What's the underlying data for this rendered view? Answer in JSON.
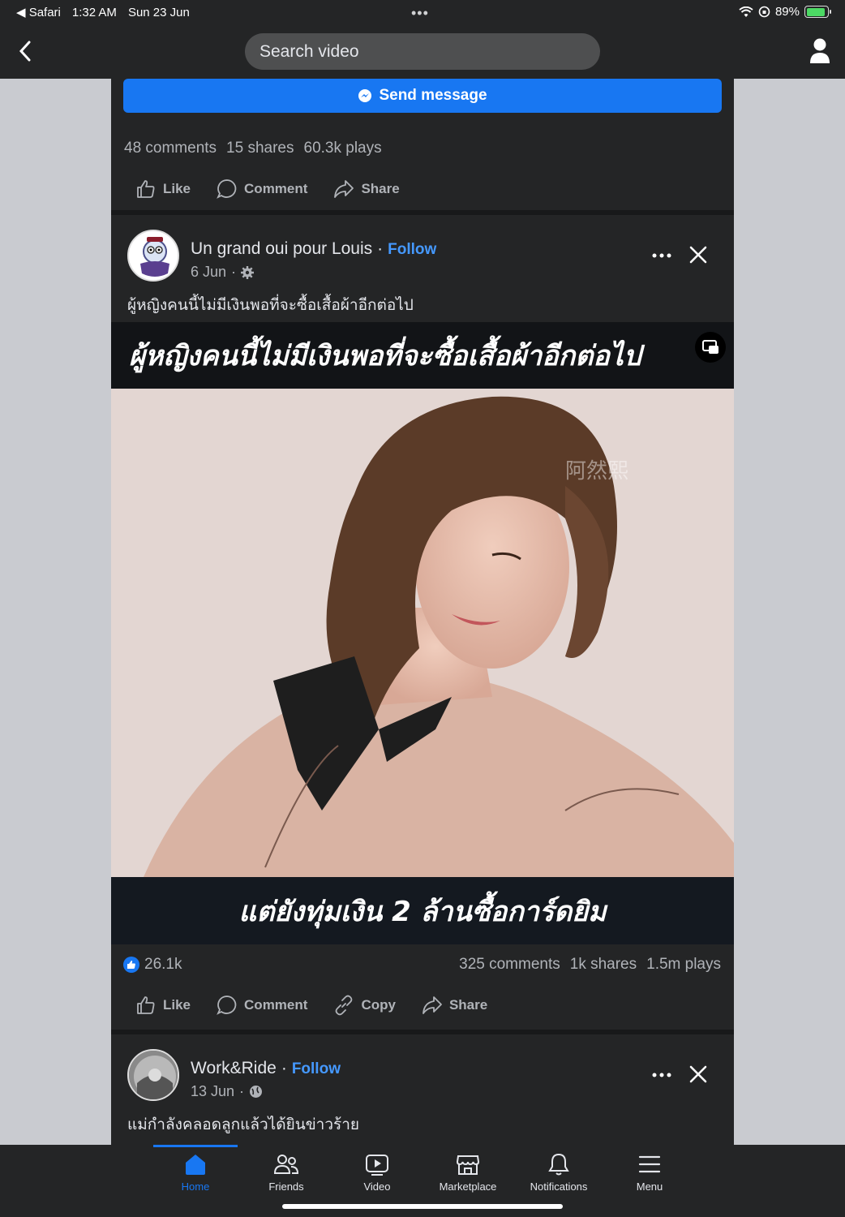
{
  "statusbar": {
    "back_app": "Safari",
    "time": "1:32 AM",
    "date": "Sun 23 Jun",
    "dots": "•••",
    "battery": "89%",
    "battery_level": 0.89
  },
  "topnav": {
    "search_placeholder": "Search video"
  },
  "post1": {
    "send_message": "Send message",
    "comments": "48 comments",
    "shares": "15 shares",
    "plays": "60.3k plays",
    "actions": {
      "like": "Like",
      "comment": "Comment",
      "share": "Share"
    }
  },
  "post2": {
    "page_name": "Un grand oui pour Louis",
    "separator": "·",
    "follow": "Follow",
    "date": "6 Jun",
    "caption": "ผู้หญิงคนนี้ไม่มีเงินพอที่จะซื้อเสื้อผ้าอีกต่อไป",
    "video_top_text": "ผู้หญิงคนนี้ไม่มีเงินพอที่จะซื้อเสื้อผ้าอีกต่อไป",
    "video_bottom_text": "แต่ยังทุ่มเงิน 2 ล้านซื้อการ์ดยิม",
    "reactions": "26.1k",
    "comments": "325 comments",
    "shares": "1k shares",
    "plays": "1.5m plays",
    "actions": {
      "like": "Like",
      "comment": "Comment",
      "copy": "Copy",
      "share": "Share"
    }
  },
  "post3": {
    "page_name": "Work&Ride",
    "separator": "·",
    "follow": "Follow",
    "date": "13 Jun",
    "caption": "แม่กำลังคลอดลูกแล้วได้ยินข่าวร้าย"
  },
  "tabbar": {
    "items": [
      {
        "label": "Home",
        "icon": "home-icon",
        "active": true
      },
      {
        "label": "Friends",
        "icon": "friends-icon"
      },
      {
        "label": "Video",
        "icon": "video-icon"
      },
      {
        "label": "Marketplace",
        "icon": "marketplace-icon"
      },
      {
        "label": "Notifications",
        "icon": "bell-icon"
      },
      {
        "label": "Menu",
        "icon": "menu-icon"
      }
    ]
  },
  "colors": {
    "accent": "#1877f2",
    "follow": "#4599ff",
    "surface": "#242526",
    "text_secondary": "#b0b3b8"
  }
}
